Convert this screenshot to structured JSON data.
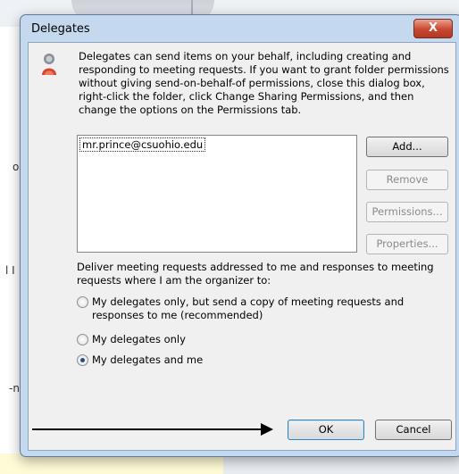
{
  "dialog": {
    "title": "Delegates",
    "close_label": "X",
    "description": "Delegates can send items on your behalf, including creating and responding to meeting requests. If you want to grant folder permissions without giving send-on-behalf-of permissions, close this dialog box, right-click the folder, click Change Sharing Permissions, and then change the options on the Permissions tab.",
    "delegates": [
      "mr.prince@csuohio.edu"
    ],
    "buttons": {
      "add": "Add...",
      "remove": "Remove",
      "permissions": "Permissions...",
      "properties": "Properties...",
      "ok": "OK",
      "cancel": "Cancel"
    },
    "deliver_text": "Deliver meeting requests addressed to me and responses to meeting requests where I am the organizer to:",
    "options": [
      {
        "label": "My delegates only, but send a copy of meeting requests and responses to me (recommended)",
        "checked": false
      },
      {
        "label": "My delegates only",
        "checked": false
      },
      {
        "label": "My delegates and me",
        "checked": true
      }
    ]
  },
  "background": {
    "fragments": [
      "o",
      "l I",
      "-n"
    ]
  },
  "colors": {
    "titlebar": "#c5d9ee",
    "close_button": "#c8472f",
    "dialog_face": "#f0f0f0"
  }
}
